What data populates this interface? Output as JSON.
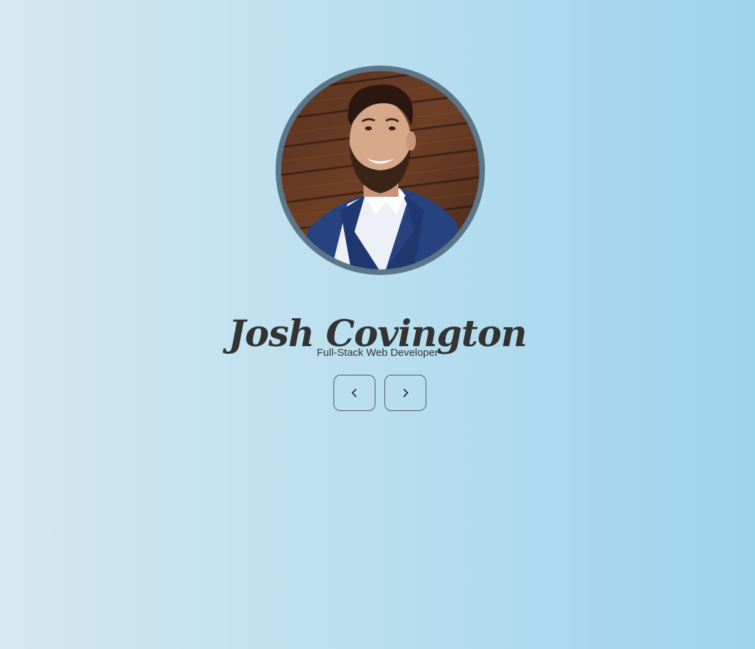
{
  "profile": {
    "name": "Josh Covington",
    "title": "Full-Stack Web Developer",
    "avatar_icon": "profile-photo",
    "ring_color": "#5b7688"
  },
  "nav": {
    "prev_icon": "chevron-left-icon",
    "next_icon": "chevron-right-icon"
  }
}
